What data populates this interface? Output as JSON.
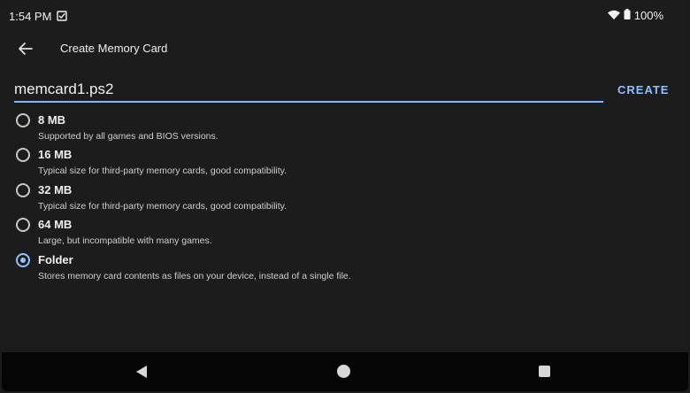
{
  "status_bar": {
    "time": "1:54 PM",
    "battery": "100%",
    "icons": [
      "checkbox-icon",
      "wifi-icon",
      "battery-icon"
    ]
  },
  "app_bar": {
    "title": "Create Memory Card",
    "back_icon": "arrow-back-icon"
  },
  "form": {
    "card_name": "memcard1.ps2",
    "create_label": "CREATE",
    "accent_color": "#8fc1ff",
    "options": [
      {
        "label": "8 MB",
        "description": "Supported by all games and BIOS versions.",
        "selected": false
      },
      {
        "label": "16 MB",
        "description": "Typical size for third-party memory cards, good compatibility.",
        "selected": false
      },
      {
        "label": "32 MB",
        "description": "Typical size for third-party memory cards, good compatibility.",
        "selected": false
      },
      {
        "label": "64 MB",
        "description": "Large, but incompatible with many games.",
        "selected": false
      },
      {
        "label": "Folder",
        "description": "Stores memory card contents as files on your device, instead of a single file.",
        "selected": true
      }
    ]
  },
  "nav_bar": {
    "buttons": [
      "back-triangle-icon",
      "home-circle-icon",
      "recents-square-icon"
    ]
  }
}
